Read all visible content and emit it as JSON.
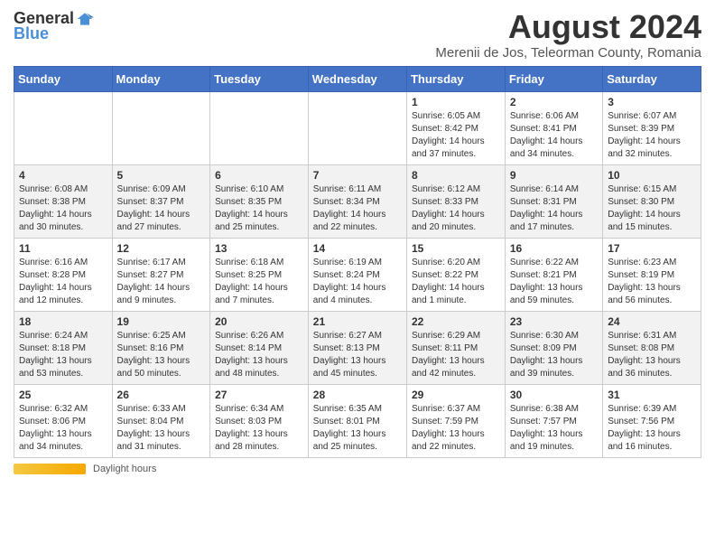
{
  "logo": {
    "general": "General",
    "blue": "Blue"
  },
  "title": "August 2024",
  "location": "Merenii de Jos, Teleorman County, Romania",
  "days_of_week": [
    "Sunday",
    "Monday",
    "Tuesday",
    "Wednesday",
    "Thursday",
    "Friday",
    "Saturday"
  ],
  "footer": {
    "daylight_label": "Daylight hours"
  },
  "weeks": [
    [
      {
        "day": "",
        "info": ""
      },
      {
        "day": "",
        "info": ""
      },
      {
        "day": "",
        "info": ""
      },
      {
        "day": "",
        "info": ""
      },
      {
        "day": "1",
        "info": "Sunrise: 6:05 AM\nSunset: 8:42 PM\nDaylight: 14 hours and 37 minutes."
      },
      {
        "day": "2",
        "info": "Sunrise: 6:06 AM\nSunset: 8:41 PM\nDaylight: 14 hours and 34 minutes."
      },
      {
        "day": "3",
        "info": "Sunrise: 6:07 AM\nSunset: 8:39 PM\nDaylight: 14 hours and 32 minutes."
      }
    ],
    [
      {
        "day": "4",
        "info": "Sunrise: 6:08 AM\nSunset: 8:38 PM\nDaylight: 14 hours and 30 minutes."
      },
      {
        "day": "5",
        "info": "Sunrise: 6:09 AM\nSunset: 8:37 PM\nDaylight: 14 hours and 27 minutes."
      },
      {
        "day": "6",
        "info": "Sunrise: 6:10 AM\nSunset: 8:35 PM\nDaylight: 14 hours and 25 minutes."
      },
      {
        "day": "7",
        "info": "Sunrise: 6:11 AM\nSunset: 8:34 PM\nDaylight: 14 hours and 22 minutes."
      },
      {
        "day": "8",
        "info": "Sunrise: 6:12 AM\nSunset: 8:33 PM\nDaylight: 14 hours and 20 minutes."
      },
      {
        "day": "9",
        "info": "Sunrise: 6:14 AM\nSunset: 8:31 PM\nDaylight: 14 hours and 17 minutes."
      },
      {
        "day": "10",
        "info": "Sunrise: 6:15 AM\nSunset: 8:30 PM\nDaylight: 14 hours and 15 minutes."
      }
    ],
    [
      {
        "day": "11",
        "info": "Sunrise: 6:16 AM\nSunset: 8:28 PM\nDaylight: 14 hours and 12 minutes."
      },
      {
        "day": "12",
        "info": "Sunrise: 6:17 AM\nSunset: 8:27 PM\nDaylight: 14 hours and 9 minutes."
      },
      {
        "day": "13",
        "info": "Sunrise: 6:18 AM\nSunset: 8:25 PM\nDaylight: 14 hours and 7 minutes."
      },
      {
        "day": "14",
        "info": "Sunrise: 6:19 AM\nSunset: 8:24 PM\nDaylight: 14 hours and 4 minutes."
      },
      {
        "day": "15",
        "info": "Sunrise: 6:20 AM\nSunset: 8:22 PM\nDaylight: 14 hours and 1 minute."
      },
      {
        "day": "16",
        "info": "Sunrise: 6:22 AM\nSunset: 8:21 PM\nDaylight: 13 hours and 59 minutes."
      },
      {
        "day": "17",
        "info": "Sunrise: 6:23 AM\nSunset: 8:19 PM\nDaylight: 13 hours and 56 minutes."
      }
    ],
    [
      {
        "day": "18",
        "info": "Sunrise: 6:24 AM\nSunset: 8:18 PM\nDaylight: 13 hours and 53 minutes."
      },
      {
        "day": "19",
        "info": "Sunrise: 6:25 AM\nSunset: 8:16 PM\nDaylight: 13 hours and 50 minutes."
      },
      {
        "day": "20",
        "info": "Sunrise: 6:26 AM\nSunset: 8:14 PM\nDaylight: 13 hours and 48 minutes."
      },
      {
        "day": "21",
        "info": "Sunrise: 6:27 AM\nSunset: 8:13 PM\nDaylight: 13 hours and 45 minutes."
      },
      {
        "day": "22",
        "info": "Sunrise: 6:29 AM\nSunset: 8:11 PM\nDaylight: 13 hours and 42 minutes."
      },
      {
        "day": "23",
        "info": "Sunrise: 6:30 AM\nSunset: 8:09 PM\nDaylight: 13 hours and 39 minutes."
      },
      {
        "day": "24",
        "info": "Sunrise: 6:31 AM\nSunset: 8:08 PM\nDaylight: 13 hours and 36 minutes."
      }
    ],
    [
      {
        "day": "25",
        "info": "Sunrise: 6:32 AM\nSunset: 8:06 PM\nDaylight: 13 hours and 34 minutes."
      },
      {
        "day": "26",
        "info": "Sunrise: 6:33 AM\nSunset: 8:04 PM\nDaylight: 13 hours and 31 minutes."
      },
      {
        "day": "27",
        "info": "Sunrise: 6:34 AM\nSunset: 8:03 PM\nDaylight: 13 hours and 28 minutes."
      },
      {
        "day": "28",
        "info": "Sunrise: 6:35 AM\nSunset: 8:01 PM\nDaylight: 13 hours and 25 minutes."
      },
      {
        "day": "29",
        "info": "Sunrise: 6:37 AM\nSunset: 7:59 PM\nDaylight: 13 hours and 22 minutes."
      },
      {
        "day": "30",
        "info": "Sunrise: 6:38 AM\nSunset: 7:57 PM\nDaylight: 13 hours and 19 minutes."
      },
      {
        "day": "31",
        "info": "Sunrise: 6:39 AM\nSunset: 7:56 PM\nDaylight: 13 hours and 16 minutes."
      }
    ]
  ]
}
